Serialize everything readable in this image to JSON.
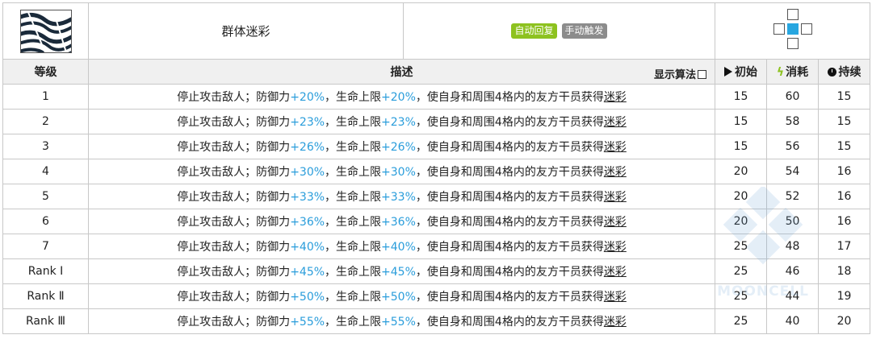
{
  "skill": {
    "icon": "zebra-stripe-skill-icon",
    "name": "群体迷彩",
    "tags": [
      {
        "label": "自动回复",
        "color": "#8dc21f"
      },
      {
        "label": "手动触发",
        "color": "#8c8c8c"
      }
    ],
    "range": {
      "self_color": "#27a6e0"
    }
  },
  "columns": {
    "level": "等级",
    "desc": "描述",
    "show_algo": "显示算法",
    "initial": "初始",
    "cost": "消耗",
    "duration": "持续"
  },
  "rows": [
    {
      "level": "1",
      "t1": "停止攻击敌人；防御力",
      "v1": "+20%",
      "t2": "，生命上限",
      "v2": "+20%",
      "t3": "，使自身和周围4格内的友方干员获得",
      "u": "迷彩",
      "initial": "15",
      "cost": "60",
      "duration": "15"
    },
    {
      "level": "2",
      "t1": "停止攻击敌人；防御力",
      "v1": "+23%",
      "t2": "，生命上限",
      "v2": "+23%",
      "t3": "，使自身和周围4格内的友方干员获得",
      "u": "迷彩",
      "initial": "15",
      "cost": "58",
      "duration": "15"
    },
    {
      "level": "3",
      "t1": "停止攻击敌人；防御力",
      "v1": "+26%",
      "t2": "，生命上限",
      "v2": "+26%",
      "t3": "，使自身和周围4格内的友方干员获得",
      "u": "迷彩",
      "initial": "15",
      "cost": "56",
      "duration": "15"
    },
    {
      "level": "4",
      "t1": "停止攻击敌人；防御力",
      "v1": "+30%",
      "t2": "，生命上限",
      "v2": "+30%",
      "t3": "，使自身和周围4格内的友方干员获得",
      "u": "迷彩",
      "initial": "20",
      "cost": "54",
      "duration": "16"
    },
    {
      "level": "5",
      "t1": "停止攻击敌人；防御力",
      "v1": "+33%",
      "t2": "，生命上限",
      "v2": "+33%",
      "t3": "，使自身和周围4格内的友方干员获得",
      "u": "迷彩",
      "initial": "20",
      "cost": "52",
      "duration": "16"
    },
    {
      "level": "6",
      "t1": "停止攻击敌人；防御力",
      "v1": "+36%",
      "t2": "，生命上限",
      "v2": "+36%",
      "t3": "，使自身和周围4格内的友方干员获得",
      "u": "迷彩",
      "initial": "20",
      "cost": "50",
      "duration": "16"
    },
    {
      "level": "7",
      "t1": "停止攻击敌人；防御力",
      "v1": "+40%",
      "t2": "，生命上限",
      "v2": "+40%",
      "t3": "，使自身和周围4格内的友方干员获得",
      "u": "迷彩",
      "initial": "25",
      "cost": "48",
      "duration": "17"
    },
    {
      "level": "Rank Ⅰ",
      "t1": "停止攻击敌人；防御力",
      "v1": "+45%",
      "t2": "，生命上限",
      "v2": "+45%",
      "t3": "，使自身和周围4格内的友方干员获得",
      "u": "迷彩",
      "initial": "25",
      "cost": "46",
      "duration": "18"
    },
    {
      "level": "Rank Ⅱ",
      "t1": "停止攻击敌人；防御力",
      "v1": "+50%",
      "t2": "，生命上限",
      "v2": "+50%",
      "t3": "，使自身和周围4格内的友方干员获得",
      "u": "迷彩",
      "initial": "25",
      "cost": "44",
      "duration": "19"
    },
    {
      "level": "Rank Ⅲ",
      "t1": "停止攻击敌人；防御力",
      "v1": "+55%",
      "t2": "，生命上限",
      "v2": "+55%",
      "t3": "，使自身和周围4格内的友方干员获得",
      "u": "迷彩",
      "initial": "25",
      "cost": "40",
      "duration": "20"
    }
  ],
  "watermark": {
    "text": "MOONCELL"
  }
}
